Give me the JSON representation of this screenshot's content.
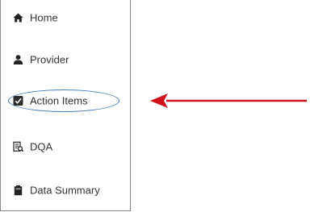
{
  "sidebar": {
    "items": [
      {
        "label": "Home",
        "icon": "home-icon"
      },
      {
        "label": "Provider",
        "icon": "user-icon"
      },
      {
        "label": "Action Items",
        "icon": "checkbox-icon"
      },
      {
        "label": "DQA",
        "icon": "report-icon"
      },
      {
        "label": "Data Summary",
        "icon": "clipboard-icon"
      }
    ]
  },
  "annotation": {
    "highlight_color": "#4a7fc1",
    "arrow_color": "#d0121b"
  },
  "colors": {
    "icon": "#222222",
    "text": "#333333",
    "border": "#8a8a8a"
  }
}
